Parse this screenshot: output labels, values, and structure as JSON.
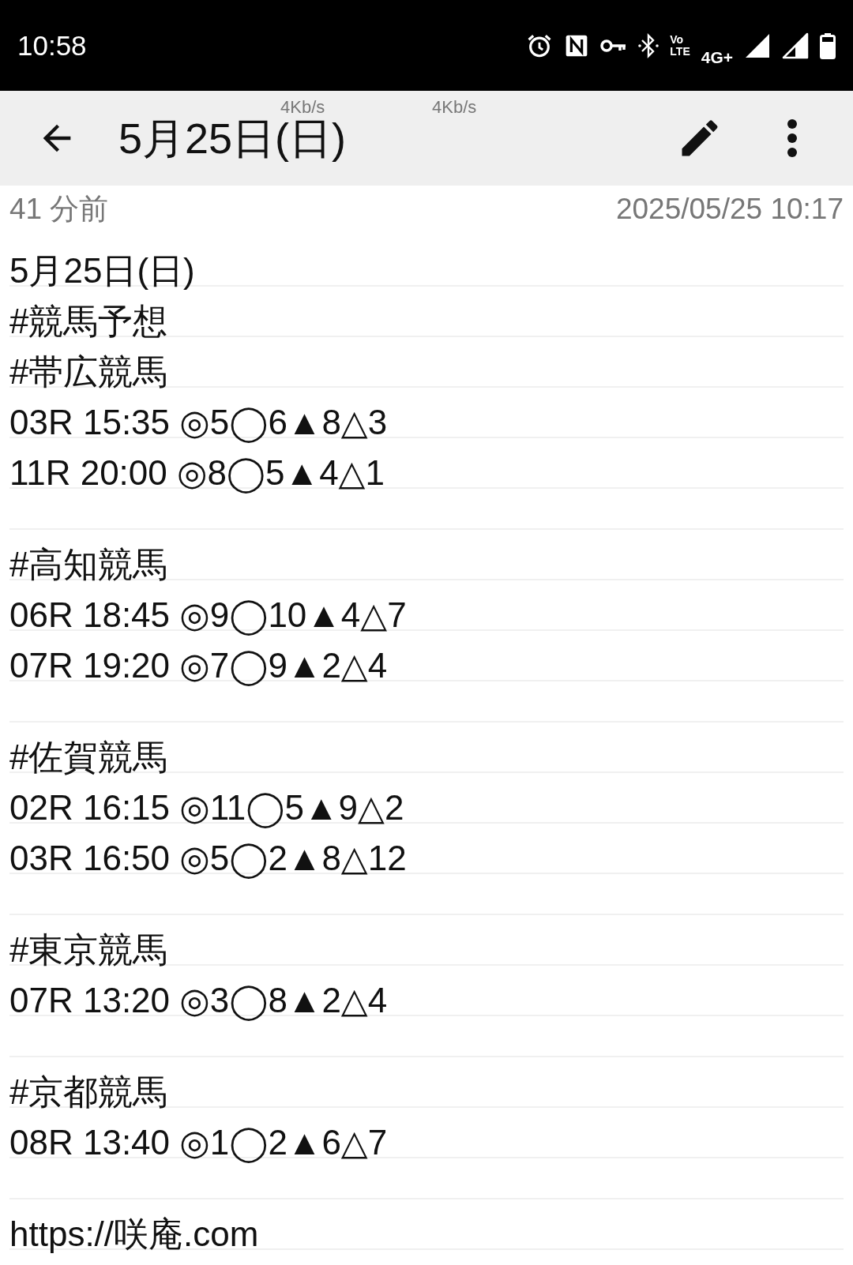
{
  "status_bar": {
    "time": "10:58",
    "volte_top": "Vo",
    "volte_bottom": "LTE",
    "network": "4G+",
    "speed_overlays": [
      "4Kb/s",
      "4Kb/s"
    ]
  },
  "toolbar": {
    "title": "5月25日(日)"
  },
  "meta": {
    "relative_time": "41 分前",
    "timestamp": "2025/05/25 10:17"
  },
  "lines": [
    {
      "kind": "text",
      "text": "5月25日(日)"
    },
    {
      "kind": "text",
      "text": "#競馬予想"
    },
    {
      "kind": "text",
      "text": "#帯広競馬"
    },
    {
      "kind": "text",
      "text": "03R 15:35 ◎5◯6▲8△3"
    },
    {
      "kind": "text",
      "text": "11R 20:00 ◎8◯5▲4△1"
    },
    {
      "kind": "blank"
    },
    {
      "kind": "text",
      "text": "#高知競馬"
    },
    {
      "kind": "text",
      "text": "06R 18:45 ◎9◯10▲4△7"
    },
    {
      "kind": "text",
      "text": "07R 19:20 ◎7◯9▲2△4"
    },
    {
      "kind": "blank"
    },
    {
      "kind": "text",
      "text": "#佐賀競馬"
    },
    {
      "kind": "text",
      "text": "02R 16:15 ◎11◯5▲9△2"
    },
    {
      "kind": "text",
      "text": "03R 16:50 ◎5◯2▲8△12"
    },
    {
      "kind": "blank"
    },
    {
      "kind": "text",
      "text": "#東京競馬"
    },
    {
      "kind": "text",
      "text": "07R 13:20 ◎3◯8▲2△4"
    },
    {
      "kind": "blank"
    },
    {
      "kind": "text",
      "text": "#京都競馬"
    },
    {
      "kind": "text",
      "text": "08R 13:40 ◎1◯2▲6△7"
    },
    {
      "kind": "blank"
    },
    {
      "kind": "text",
      "text": "https://咲庵.com"
    }
  ]
}
